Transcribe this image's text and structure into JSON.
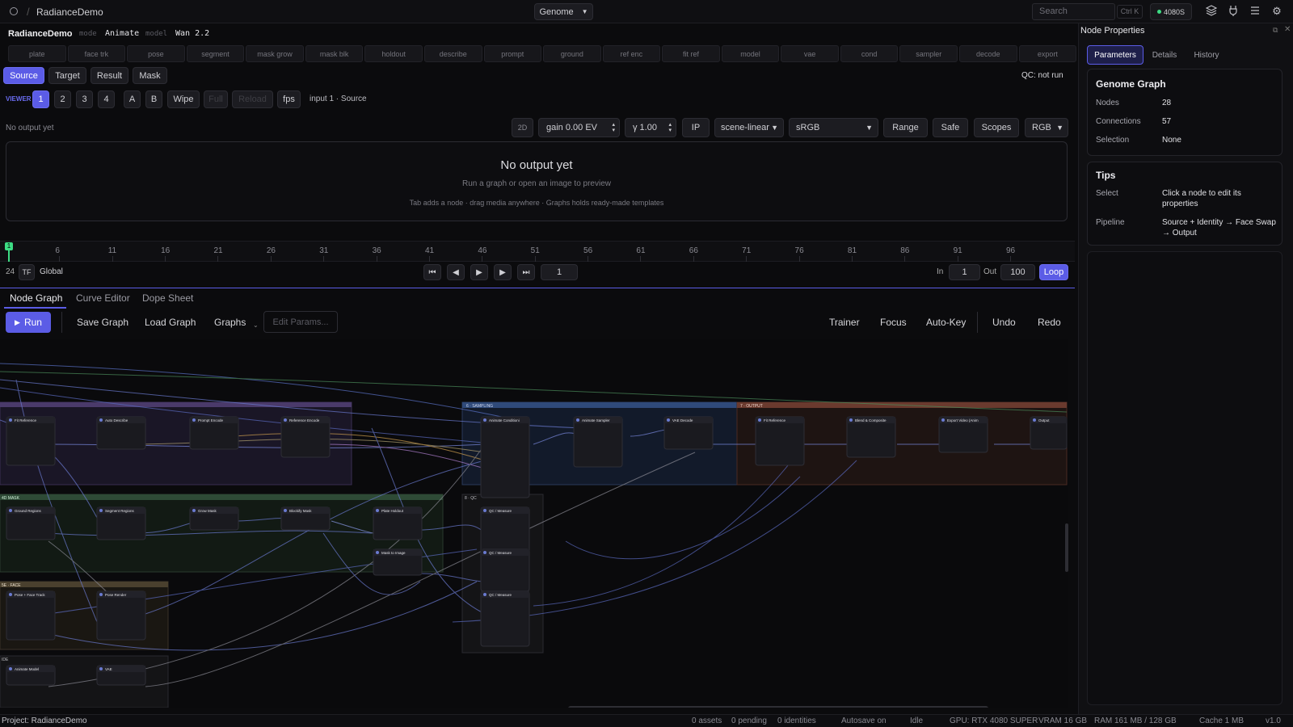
{
  "topbar": {
    "project_name": "RadianceDemo",
    "genome_select": "Genome",
    "search_placeholder": "Search",
    "search_shortcut": "Ctrl K",
    "gpu_chip": "4080S",
    "icons": [
      "layers-icon",
      "plug-icon",
      "menu-icon",
      "gear-icon"
    ]
  },
  "titlebar": {
    "app_title": "RadianceDemo",
    "mode_key": "mode",
    "mode_value": "Animate",
    "model_key": "model",
    "model_value": "Wan 2.2"
  },
  "stages": [
    "plate",
    "face trk",
    "pose",
    "segment",
    "mask grow",
    "mask blk",
    "holdout",
    "describe",
    "prompt",
    "ground",
    "ref enc",
    "fit ref",
    "model",
    "vae",
    "cond",
    "sampler",
    "decode",
    "export"
  ],
  "view_tabs": [
    "Source",
    "Target",
    "Result",
    "Mask"
  ],
  "view_tab_active": "Source",
  "qc_status": "QC: not run",
  "viewer": {
    "label": "VIEWER",
    "slots": [
      "1",
      "2",
      "3",
      "4"
    ],
    "active_slot": "1",
    "compare": [
      "A",
      "B",
      "Wipe",
      "Full",
      "Reload",
      "fps"
    ],
    "input_label": "input 1 · Source"
  },
  "output_controls": {
    "status": "No output yet",
    "dim": "2D",
    "gain": "gain 0.00 EV",
    "gamma": "γ 1.00",
    "ip": "IP",
    "colorspace": "scene-linear",
    "display": "sRGB",
    "range": "Range",
    "safe": "Safe",
    "scopes": "Scopes",
    "channel": "RGB"
  },
  "preview": {
    "title": "No output yet",
    "subtitle": "Run a graph or open an image to preview",
    "hints": "Tab adds a node · drag media anywhere · Graphs holds ready-made templates"
  },
  "timeline": {
    "ticks": [
      "6",
      "11",
      "16",
      "21",
      "26",
      "31",
      "36",
      "41",
      "46",
      "51",
      "56",
      "61",
      "66",
      "71",
      "76",
      "81",
      "86",
      "91",
      "96"
    ],
    "playhead": "1",
    "fps": "24",
    "tf": "TF",
    "scope": "Global",
    "frame": "1",
    "in_label": "In",
    "in_value": "1",
    "out_label": "Out",
    "out_value": "100",
    "loop": "Loop"
  },
  "bottom_tabs": [
    "Node Graph",
    "Curve Editor",
    "Dope Sheet"
  ],
  "graph_toolbar": {
    "run": "Run",
    "save": "Save Graph",
    "load": "Load Graph",
    "graphs": "Graphs",
    "edit_params": "Edit Params...",
    "trainer": "Trainer",
    "focus": "Focus",
    "auto_key": "Auto-Key",
    "undo": "Undo",
    "redo": "Redo"
  },
  "graph_groups": [
    {
      "title": "",
      "color": "#6a4a8a"
    },
    {
      "title": "6 · SAMPLING",
      "color": "#3a5a9a"
    },
    {
      "title": "7 · OUTPUT",
      "color": "#8a4a3a"
    },
    {
      "title": "4D MASK",
      "color": "#3a6a4a"
    },
    {
      "title": "8 · QC",
      "color": "#4a4a52"
    },
    {
      "title": "5E · FACE",
      "color": "#6a5a3a"
    },
    {
      "title": "IDE",
      "color": "#4a4a52"
    }
  ],
  "graph_nodes": [
    "Fit Reference",
    "Auto Describe",
    "Prompt Encode",
    "Reference Encode",
    "Animate Conditioni",
    "Animate Sampler",
    "VAE Decode",
    "Fit Reference",
    "Blend & Composite",
    "Export Video (Anim",
    "Output",
    "Ground Regions",
    "Segment Regions",
    "Grow Mask",
    "Blockify Mask",
    "Plate Holdout",
    "QC / Measure",
    "Mask to Image",
    "QC / Measure",
    "QC / Measure",
    "Pose + Face Track",
    "Pose Render",
    "Animate Model",
    "VAE"
  ],
  "right_panel": {
    "title": "Node Properties",
    "tabs": [
      "Parameters",
      "Details",
      "History"
    ],
    "active_tab": "Parameters",
    "graph_card": {
      "title": "Genome Graph",
      "rows": [
        {
          "key": "Nodes",
          "value": "28"
        },
        {
          "key": "Connections",
          "value": "57"
        },
        {
          "key": "Selection",
          "value": "None"
        }
      ]
    },
    "tips_card": {
      "title": "Tips",
      "rows": [
        {
          "key": "Select",
          "value": "Click a node to edit its properties"
        },
        {
          "key": "Pipeline",
          "value": "Source + Identity → Face Swap → Output"
        }
      ]
    }
  },
  "statusbar": {
    "project": "Project: RadianceDemo",
    "assets": "0 assets",
    "pending": "0 pending",
    "identities": "0 identities",
    "autosave": "Autosave on",
    "state": "Idle",
    "gpu": "GPU: RTX 4080 SUPER",
    "vram": "VRAM 16 GB",
    "ram": "RAM 161 MB / 128 GB",
    "cache": "Cache 1 MB",
    "version": "v1.0"
  },
  "colors": {
    "accent": "#5b5ce6",
    "playhead": "#3ddc84",
    "background": "#0b0b0d"
  }
}
